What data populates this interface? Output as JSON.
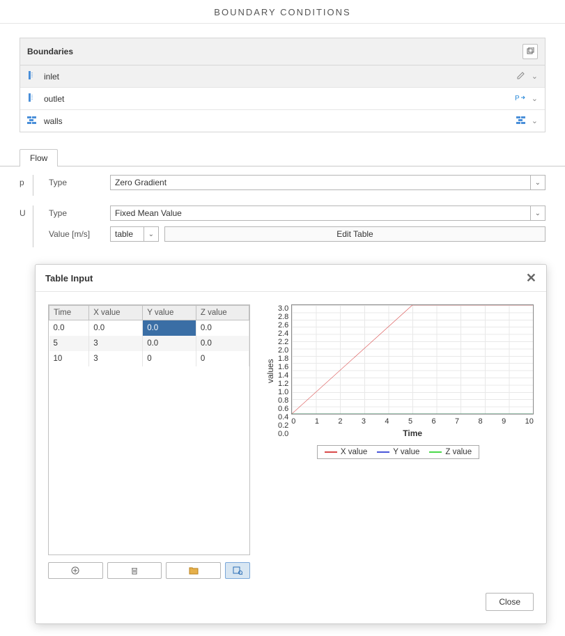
{
  "page_title": "BOUNDARY CONDITIONS",
  "boundaries": {
    "header": "Boundaries",
    "items": [
      {
        "name": "inlet",
        "type": "patch",
        "selected": true,
        "right_icon": "edit"
      },
      {
        "name": "outlet",
        "type": "patch",
        "selected": false,
        "right_icon": "pressure"
      },
      {
        "name": "walls",
        "type": "wall",
        "selected": false,
        "right_icon": "wall"
      }
    ]
  },
  "tabs": {
    "active": "Flow"
  },
  "fields": {
    "p": {
      "label": "p",
      "type_label": "Type",
      "type_value": "Zero Gradient"
    },
    "U": {
      "label": "U",
      "type_label": "Type",
      "type_value": "Fixed Mean Value",
      "value_label": "Value [m/s]",
      "value_mode": "table",
      "edit_label": "Edit Table"
    }
  },
  "dialog": {
    "title": "Table Input",
    "headers": [
      "Time",
      "X value",
      "Y value",
      "Z value"
    ],
    "rows": [
      [
        "0.0",
        "0.0",
        "0.0",
        "0.0"
      ],
      [
        "5",
        "3",
        "0.0",
        "0.0"
      ],
      [
        "10",
        "3",
        "0",
        "0"
      ]
    ],
    "selected_cell": [
      0,
      2
    ],
    "close_label": "Close"
  },
  "chart_data": {
    "type": "line",
    "title": "",
    "xlabel": "Time",
    "ylabel": "values",
    "xlim": [
      0,
      10
    ],
    "ylim": [
      0,
      3.0
    ],
    "xticks": [
      0,
      1,
      2,
      3,
      4,
      5,
      6,
      7,
      8,
      9,
      10
    ],
    "yticks": [
      0.0,
      0.2,
      0.4,
      0.6,
      0.8,
      1.0,
      1.2,
      1.4,
      1.6,
      1.8,
      2.0,
      2.2,
      2.4,
      2.6,
      2.8,
      3.0
    ],
    "x": [
      0,
      5,
      10
    ],
    "series": [
      {
        "name": "X value",
        "color": "#d94a4a",
        "values": [
          0.0,
          3.0,
          3.0
        ]
      },
      {
        "name": "Y value",
        "color": "#4a57d9",
        "values": [
          0.0,
          0.0,
          0.0
        ]
      },
      {
        "name": "Z value",
        "color": "#4ad94a",
        "values": [
          0.0,
          0.0,
          0.0
        ]
      }
    ]
  }
}
